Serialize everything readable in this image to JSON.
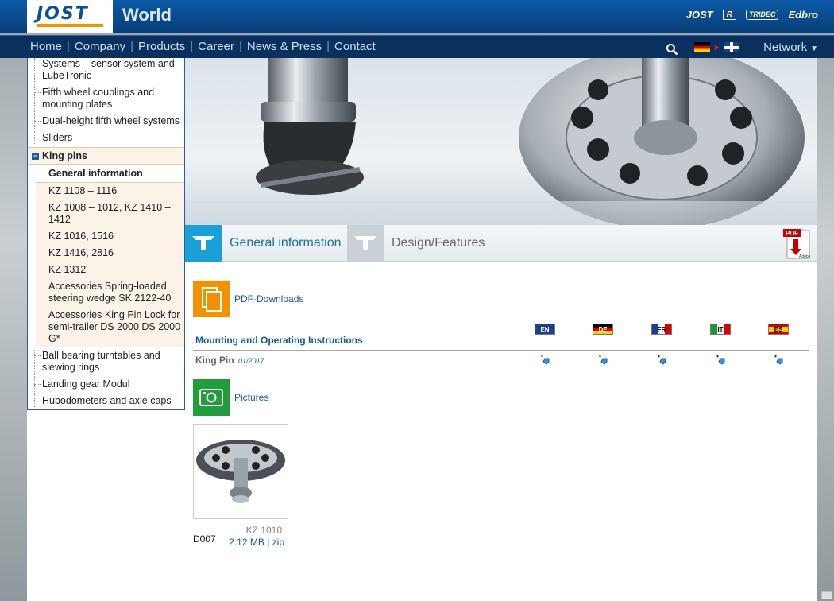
{
  "header": {
    "title": "World",
    "logo": "JOST",
    "brands": [
      "JOST",
      "R",
      "TRIDEC",
      "Edbro"
    ]
  },
  "nav": {
    "items": [
      "Home",
      "Company",
      "Products",
      "Career",
      "News & Press",
      "Contact"
    ],
    "network_label": "Network"
  },
  "sidebar": {
    "items_top": [
      "Systems – sensor system and LubeTronic",
      "Fifth wheel couplings and mounting plates",
      "Dual-height fifth wheel systems",
      "Sliders"
    ],
    "kingpins": {
      "label": "King pins",
      "children": [
        "General information",
        "KZ 1108 – 1116",
        "KZ 1008 – 1012, KZ 1410 – 1412",
        "KZ 1016, 1516",
        "KZ 1416, 2816",
        "KZ 1312",
        "Accessories Spring-loaded steering wedge SK 2122-40",
        "Accessories King Pin Lock for semi-trailer DS 2000 DS 2000 G*"
      ]
    },
    "items_bottom": [
      "Ball bearing turntables and slewing rings",
      "Landing gear Modul",
      "Hubodometers and axle caps"
    ]
  },
  "tabs": [
    "General information",
    "Design/Features"
  ],
  "pdf_icon_label": "PDF",
  "pdf_icon_brand": "Adobe",
  "downloads": {
    "title": "PDF-Downloads",
    "heading": "Mounting and Operating Instructions",
    "languages": [
      "EN",
      "DE",
      "FR",
      "IT",
      "ES"
    ],
    "row": {
      "name": "King Pin",
      "date": "01/2017"
    }
  },
  "pictures": {
    "title": "Pictures",
    "item": {
      "code": "D007",
      "name": "KZ 1010",
      "size": "2.12 MB",
      "format": "zip"
    }
  }
}
